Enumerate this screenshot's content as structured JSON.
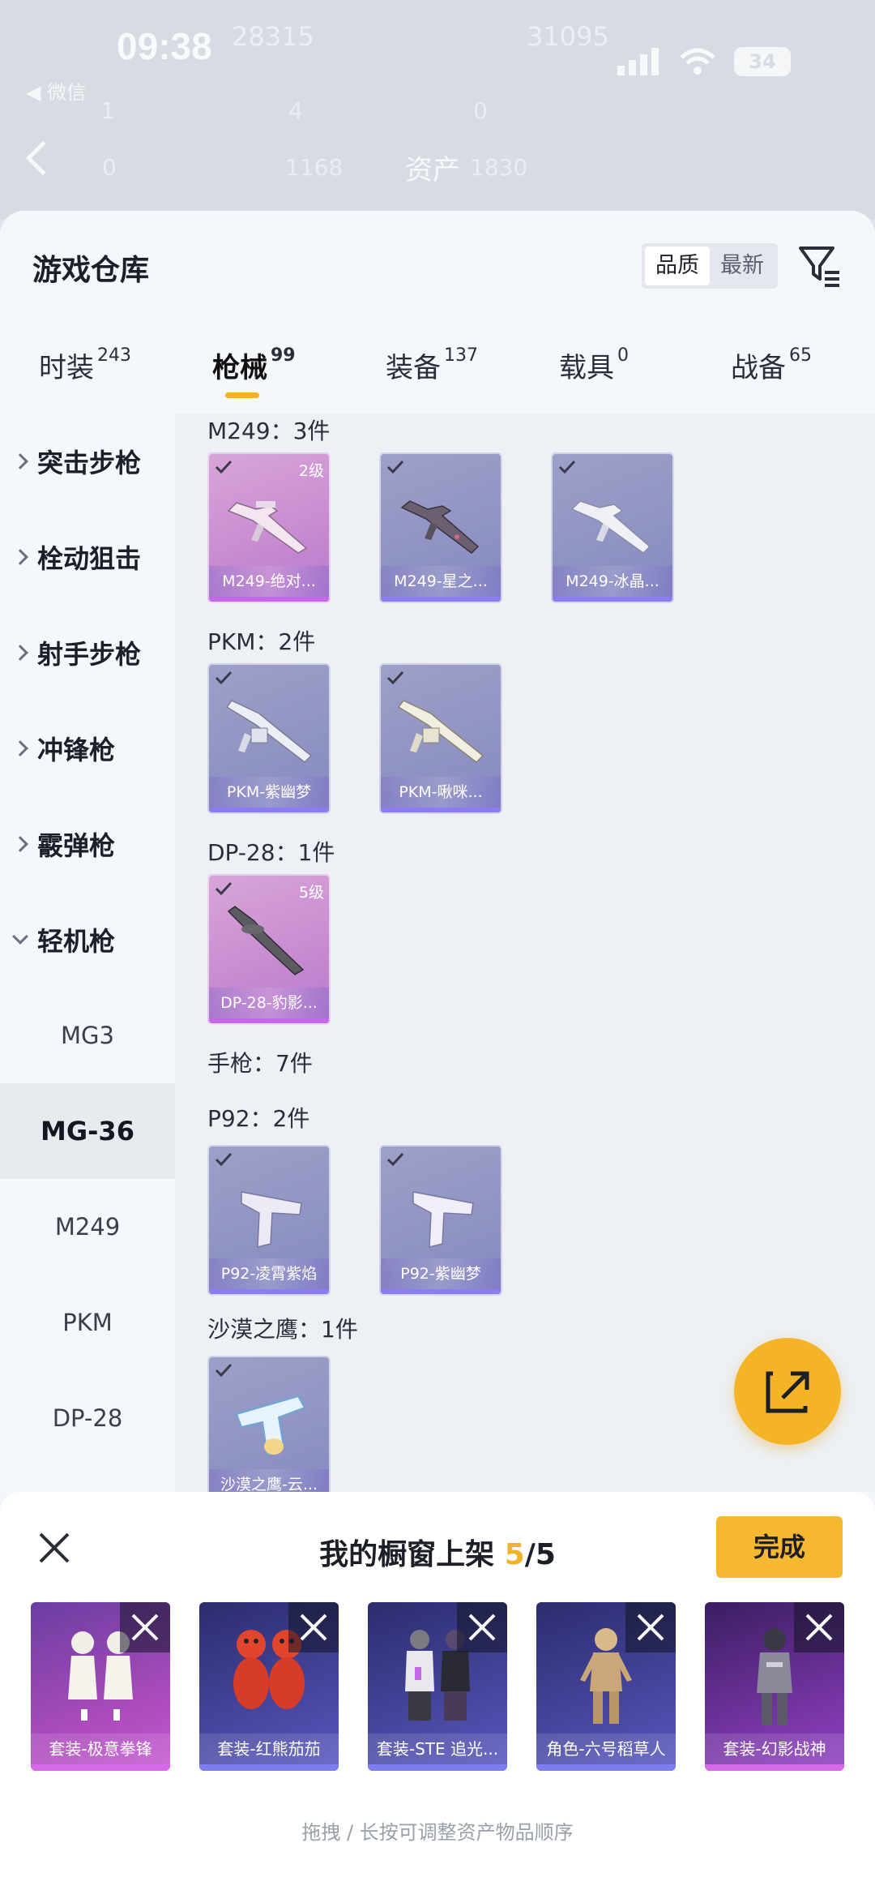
{
  "status": {
    "time": "09:38",
    "battery": "34",
    "back_app": "◀ 微信"
  },
  "bg": {
    "title": "资产",
    "n1": "28315",
    "n2": "31095",
    "n3": "1",
    "n4": "4",
    "n5": "0",
    "n6": "0",
    "n7": "1168",
    "n8": "1830"
  },
  "header": {
    "title": "游戏仓库",
    "sort_quality": "品质",
    "sort_newest": "最新"
  },
  "tabs": [
    {
      "label": "时装",
      "count": "243"
    },
    {
      "label": "枪械",
      "count": "99"
    },
    {
      "label": "装备",
      "count": "137"
    },
    {
      "label": "载具",
      "count": "0"
    },
    {
      "label": "战备",
      "count": "65"
    }
  ],
  "sidebar": {
    "categories": [
      "突击步枪",
      "栓动狙击",
      "射手步枪",
      "冲锋枪",
      "霰弹枪",
      "轻机枪"
    ],
    "subitems": [
      "MG3",
      "MG-36",
      "M249",
      "PKM",
      "DP-28"
    ],
    "selected": "MG-36"
  },
  "groups": [
    {
      "title": "M249：3件",
      "items": [
        {
          "name": "M249-绝对...",
          "level": "2级",
          "tone": "pink"
        },
        {
          "name": "M249-星之...",
          "level": "",
          "tone": "purple"
        },
        {
          "name": "M249-冰晶...",
          "level": "",
          "tone": "purple"
        }
      ]
    },
    {
      "title": "PKM：2件",
      "items": [
        {
          "name": "PKM-紫幽梦",
          "level": "",
          "tone": "purple"
        },
        {
          "name": "PKM-啾咪...",
          "level": "",
          "tone": "purple"
        }
      ]
    },
    {
      "title": "DP-28：1件",
      "items": [
        {
          "name": "DP-28-豹影...",
          "level": "5级",
          "tone": "pink"
        }
      ]
    },
    {
      "title": "手枪：7件",
      "items": []
    },
    {
      "title": "P92：2件",
      "items": [
        {
          "name": "P92-凌霄紫焰",
          "level": "",
          "tone": "purple"
        },
        {
          "name": "P92-紫幽梦",
          "level": "",
          "tone": "purple"
        }
      ]
    },
    {
      "title": "沙漠之鹰：1件",
      "items": [
        {
          "name": "沙漠之鹰-云...",
          "level": "",
          "tone": "purple"
        }
      ]
    }
  ],
  "drawer": {
    "title": "我的橱窗上架 ",
    "current": "5",
    "total": "/5",
    "done": "完成",
    "hint": "拖拽 / 长按可调整资产物品顺序",
    "slots": [
      "套装-极意拳锋",
      "套装-红熊茄茄",
      "套装-STE 追光...",
      "角色-六号稻草人",
      "套装-幻影战神"
    ]
  },
  "colors": {
    "accent": "#f5b428",
    "purple_card": "#8f93c2",
    "pink_card": "#c78ad0"
  }
}
